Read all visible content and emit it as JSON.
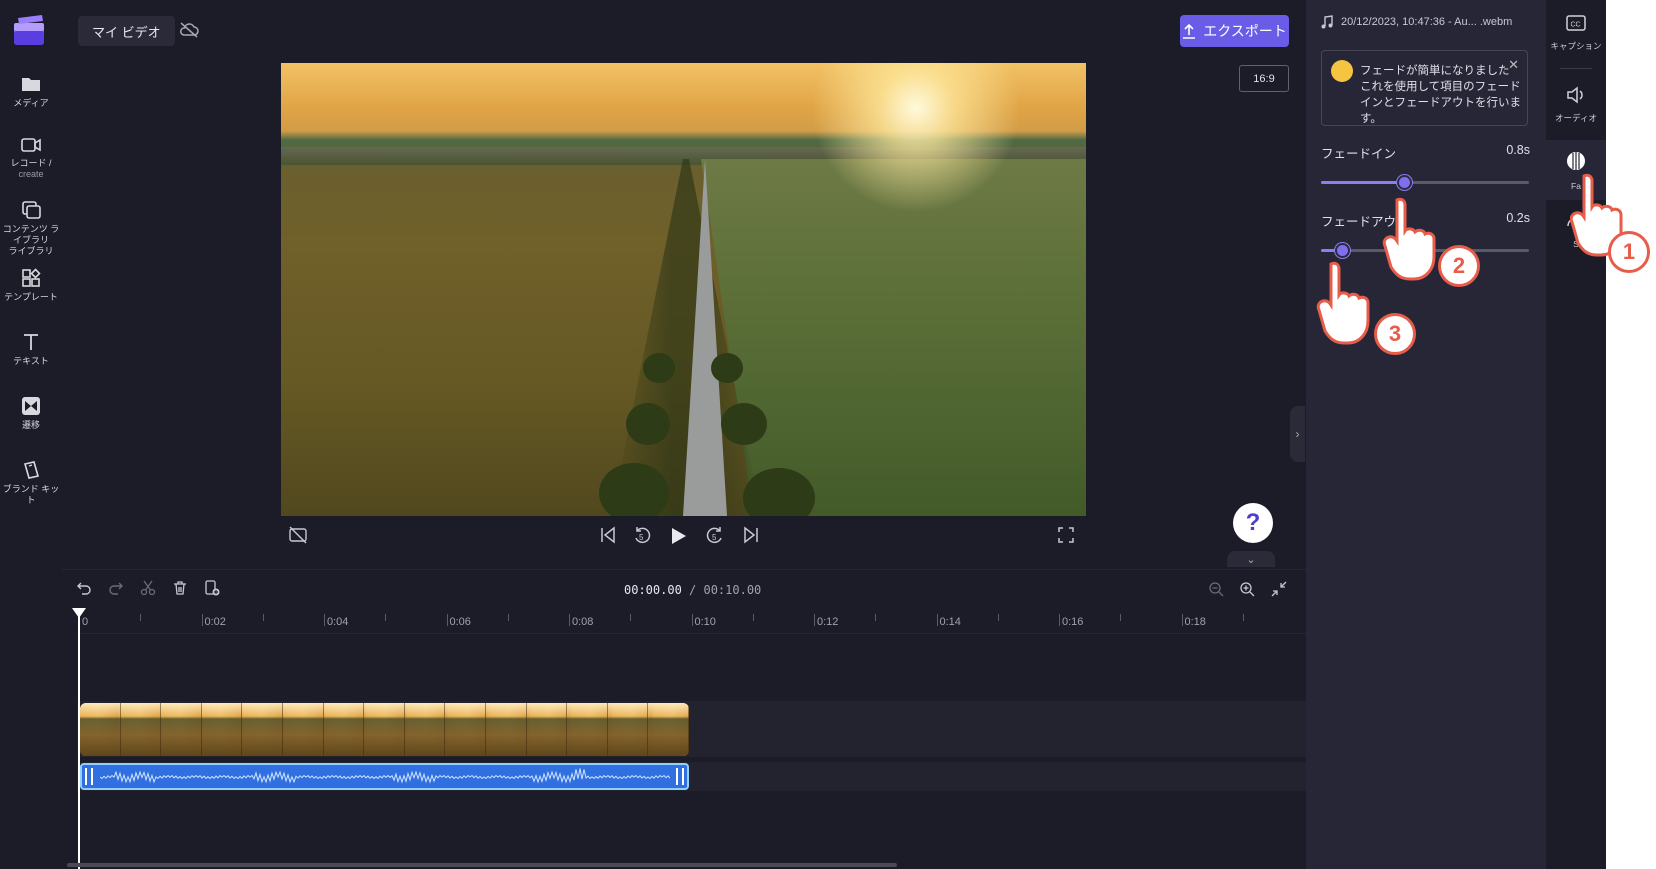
{
  "nav": {
    "items": [
      {
        "label": "メディア",
        "sub": ""
      },
      {
        "label": "レコード /",
        "sub": "create"
      },
      {
        "label": "コンテンツ ライブラリ",
        "sub": "ライブラリ"
      },
      {
        "label": "テンプレート",
        "sub": ""
      },
      {
        "label": "テキスト",
        "sub": ""
      },
      {
        "label": "遷移",
        "sub": ""
      },
      {
        "label": "ブランド キット",
        "sub": ""
      }
    ]
  },
  "header": {
    "project_title": "マイ ビデオ",
    "export_label": "エクスポート",
    "aspect_ratio": "16:9"
  },
  "playback": {
    "current_time": "00:00.00",
    "separator": " / ",
    "total_time": "00:10.00"
  },
  "help": {
    "label": "?"
  },
  "timeline": {
    "ticks": [
      "0",
      "0:02",
      "0:04",
      "0:06",
      "0:08",
      "0:10",
      "0:12",
      "0:14",
      "0:16",
      "0:18"
    ]
  },
  "properties": {
    "file_name": "20/12/2023, 10:47:36 - Au... .webm",
    "toast_message": "フェードが簡単になりました これを使用して項目のフェードインとフェードアウトを行います。",
    "fade_in": {
      "label": "フェードイン",
      "value": "0.8s",
      "fraction": 0.4
    },
    "fade_out": {
      "label": "フェードアウト",
      "value": "0.2s",
      "fraction": 0.1
    }
  },
  "rail": {
    "items": [
      {
        "label": "キャプション"
      },
      {
        "label": "オーディオ"
      },
      {
        "label": "Fa"
      },
      {
        "label": "S"
      }
    ]
  },
  "callouts": [
    "1",
    "2",
    "3"
  ],
  "colors": {
    "accent": "#6b5ce7",
    "background": "#1c1c28",
    "panel": "#262636",
    "audio_clip": "#2f6fe0",
    "callout": "#e85c4a"
  }
}
